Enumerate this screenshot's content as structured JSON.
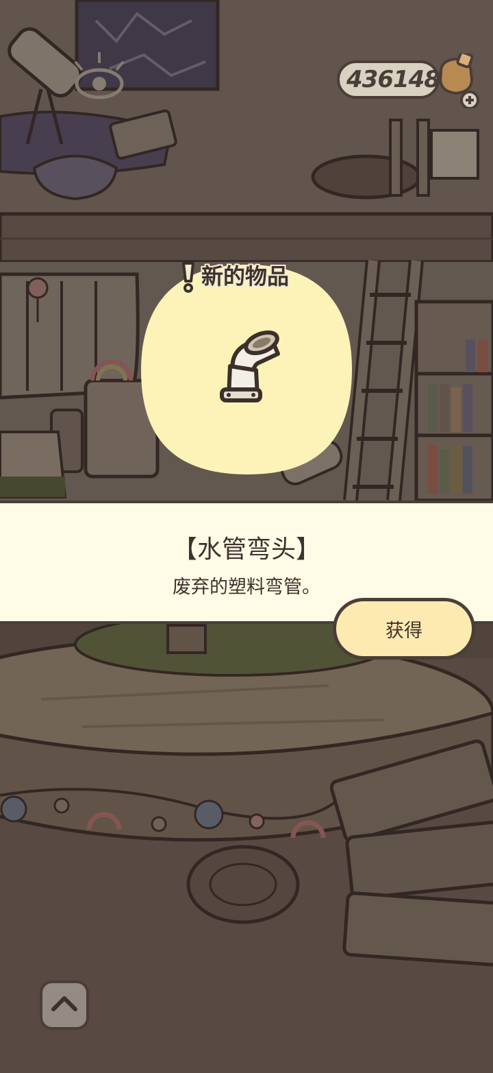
{
  "currency": {
    "value": "436148",
    "icon": "coin-jar-plus-icon"
  },
  "popup": {
    "title": "新的物品",
    "title_icon": "exclamation-icon",
    "item_icon": "pipe-elbow-icon",
    "item_name": "【水管弯头】",
    "item_description": "废弃的塑料弯管。",
    "obtain_label": "获得"
  },
  "bottom_bar": {
    "expand_icon": "chevron-up-icon"
  },
  "colors": {
    "outline": "#4b3d37",
    "panel": "#fffbe6",
    "button": "#fdeab0",
    "blob": "#fdf3b8"
  }
}
